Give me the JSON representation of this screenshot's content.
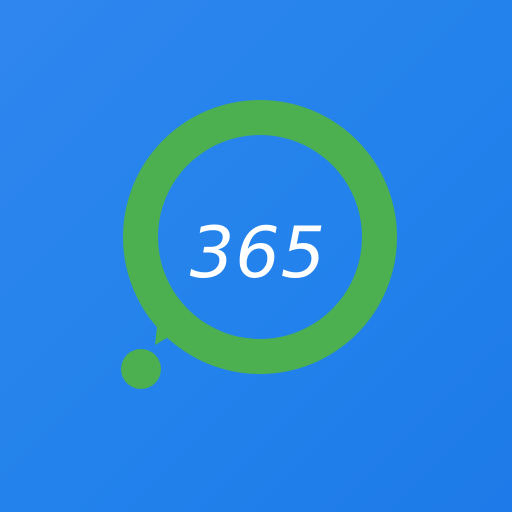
{
  "app_icon": {
    "label": "365",
    "icon_name": "chat-bubble-ring-icon",
    "colors": {
      "background": "#2382ec",
      "ring": "#4caf50",
      "text": "#ffffff"
    }
  }
}
